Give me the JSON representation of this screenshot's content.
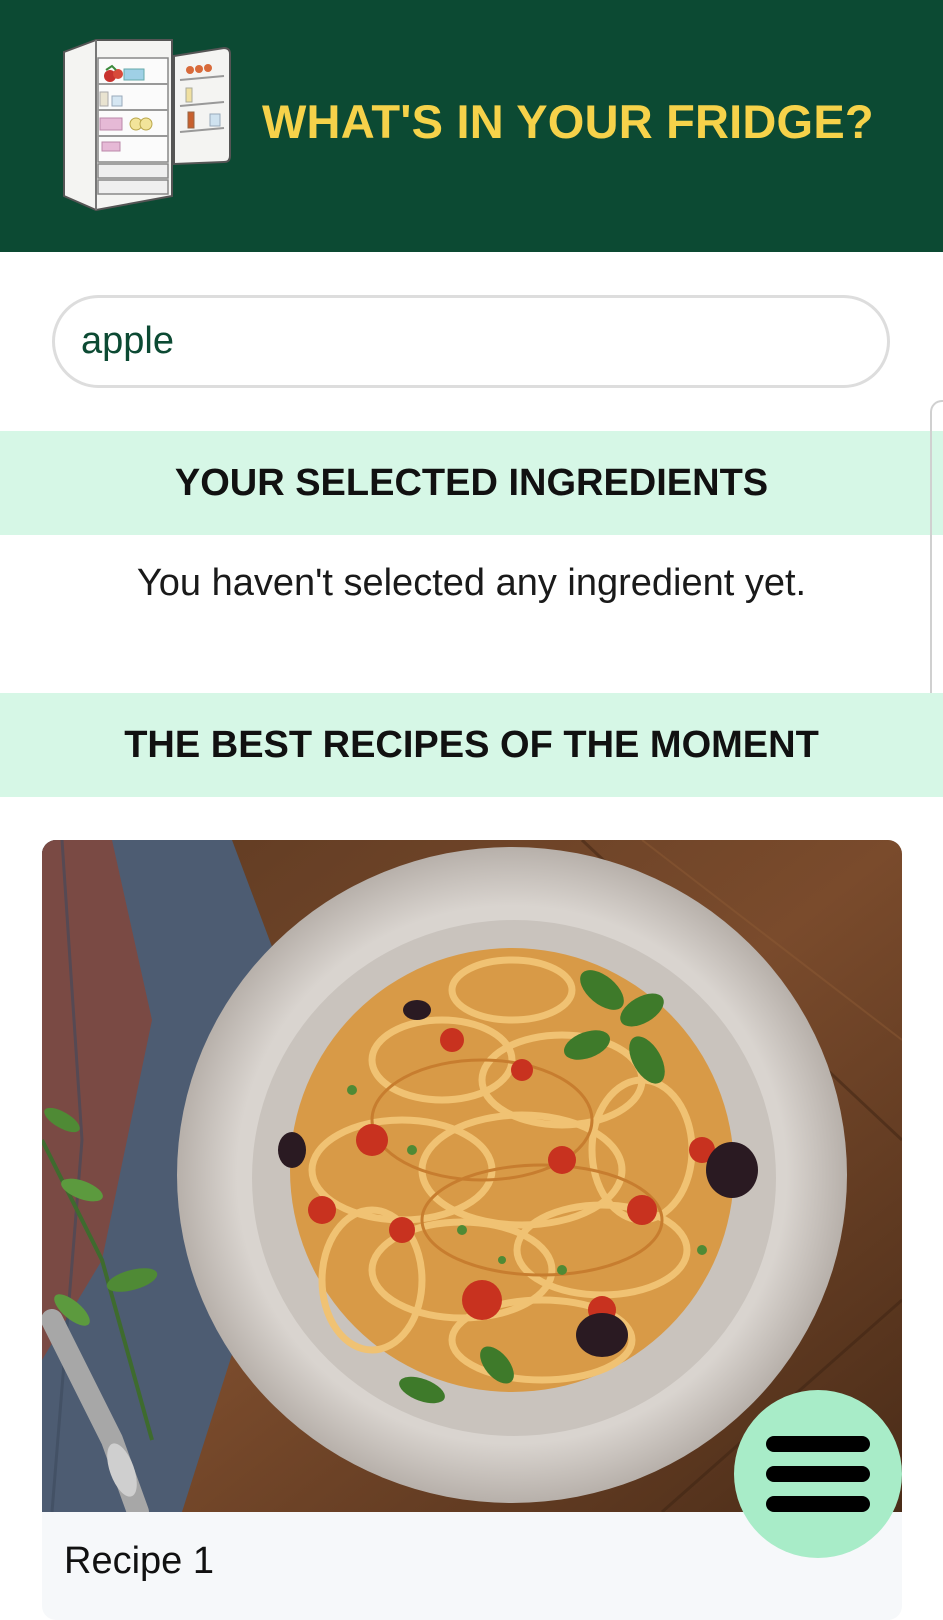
{
  "header": {
    "title": "WHAT'S IN YOUR FRIDGE?",
    "logo_icon": "fridge-icon",
    "background_color": "#0c4a33",
    "title_color": "#f6d24a"
  },
  "search": {
    "value": "apple",
    "icon": "none"
  },
  "selected_ingredients": {
    "heading": "YOUR SELECTED INGREDIENTS",
    "empty_message": "You haven't selected any ingredient yet.",
    "band_color": "#d6f7e6"
  },
  "recipes": {
    "heading": "THE BEST RECIPES OF THE MOMENT",
    "items": [
      {
        "title": "Recipe 1",
        "image": "pasta-bowl-photo"
      }
    ]
  },
  "fab": {
    "icon": "hamburger-menu-icon",
    "color": "#a8ecc8"
  }
}
